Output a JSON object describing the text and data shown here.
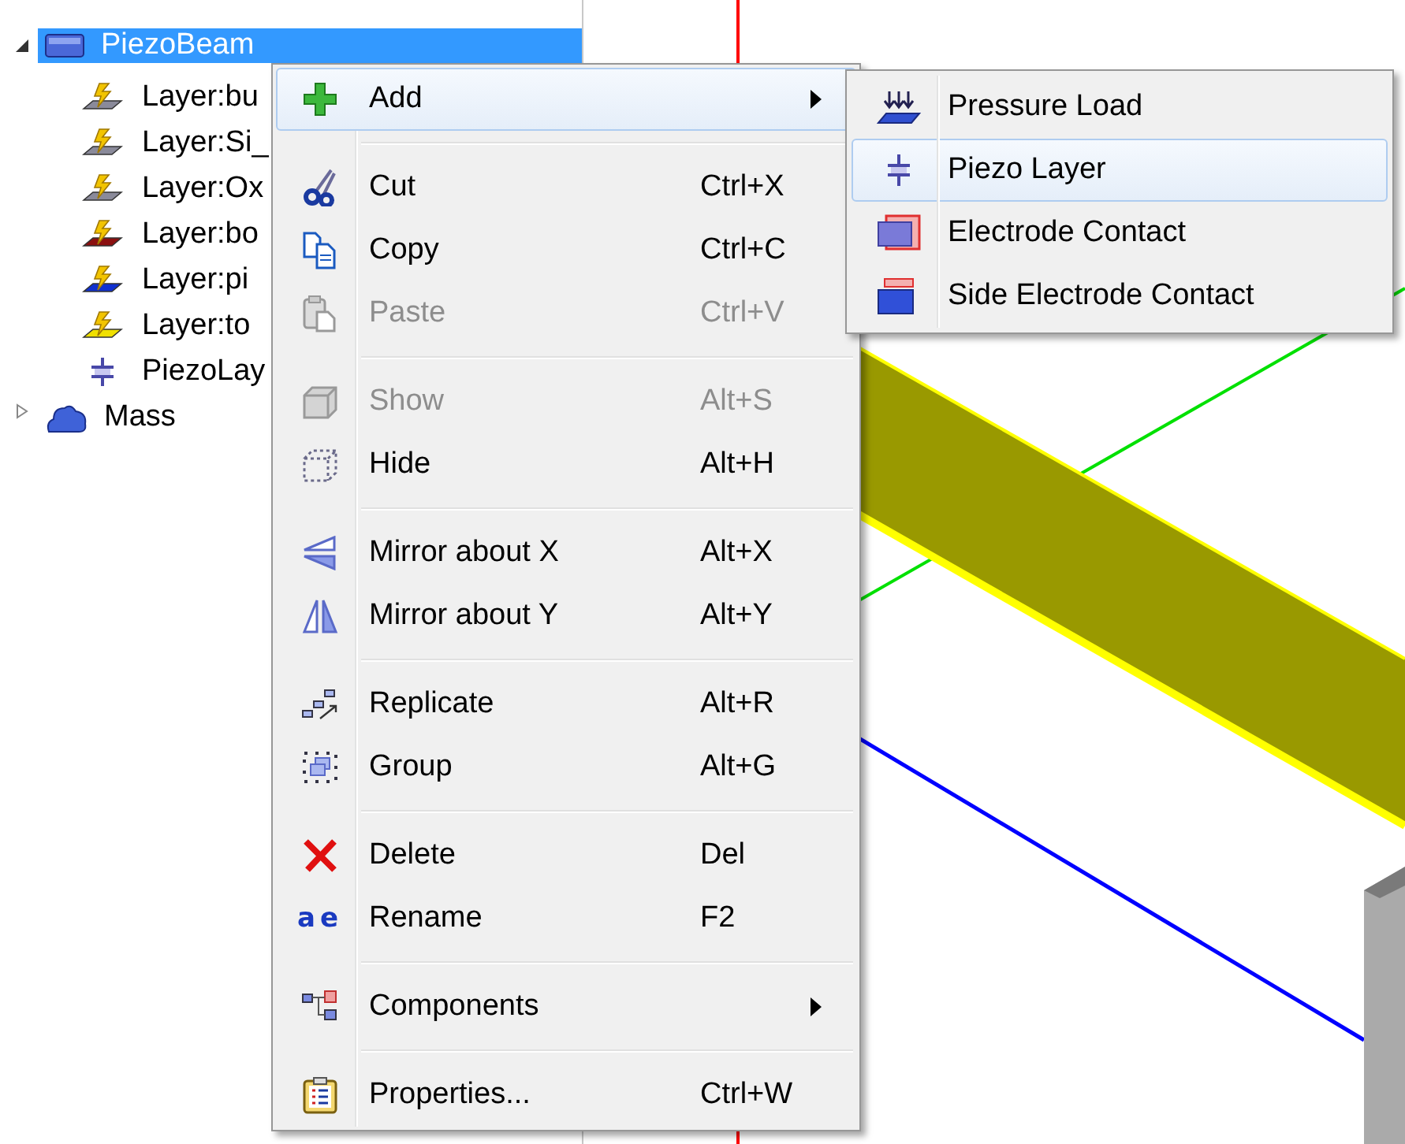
{
  "tree": {
    "items": [
      {
        "label": "PiezoBeam",
        "kind": "beam",
        "expanded": true,
        "selected": true,
        "children": [
          {
            "label": "Layer:bu",
            "kind": "layer",
            "color": "#8a8a9a",
            "selected": false
          },
          {
            "label": "Layer:Si_",
            "kind": "layer",
            "color": "#8a8a9a",
            "selected": false
          },
          {
            "label": "Layer:Ox",
            "kind": "layer",
            "color": "#8a8a9a",
            "selected": false
          },
          {
            "label": "Layer:bo",
            "kind": "layer",
            "color": "#8b1010",
            "selected": false
          },
          {
            "label": "Layer:pi",
            "kind": "layer",
            "color": "#1030d0",
            "selected": false
          },
          {
            "label": "Layer:to",
            "kind": "layer",
            "color": "#f0e000",
            "selected": false
          },
          {
            "label": "PiezoLay",
            "kind": "piezo",
            "selected": false
          }
        ]
      },
      {
        "label": "Mass",
        "kind": "mass",
        "expanded": false,
        "selected": false
      }
    ]
  },
  "context_menu": {
    "items": [
      {
        "kind": "item",
        "label": "Add",
        "submenu": true,
        "disabled": false,
        "selected": true
      },
      {
        "kind": "separator"
      },
      {
        "kind": "item",
        "label": "Cut",
        "shortcut": "Ctrl+X",
        "submenu": false,
        "disabled": false,
        "selected": false
      },
      {
        "kind": "item",
        "label": "Copy",
        "shortcut": "Ctrl+C",
        "submenu": false,
        "disabled": false,
        "selected": false
      },
      {
        "kind": "item",
        "label": "Paste",
        "shortcut": "Ctrl+V",
        "submenu": false,
        "disabled": true,
        "selected": false
      },
      {
        "kind": "separator"
      },
      {
        "kind": "item",
        "label": "Show",
        "shortcut": "Alt+S",
        "submenu": false,
        "disabled": true,
        "selected": false
      },
      {
        "kind": "item",
        "label": "Hide",
        "shortcut": "Alt+H",
        "submenu": false,
        "disabled": false,
        "selected": false
      },
      {
        "kind": "separator"
      },
      {
        "kind": "item",
        "label": "Mirror about X",
        "shortcut": "Alt+X",
        "submenu": false,
        "disabled": false,
        "selected": false
      },
      {
        "kind": "item",
        "label": "Mirror about Y",
        "shortcut": "Alt+Y",
        "submenu": false,
        "disabled": false,
        "selected": false
      },
      {
        "kind": "separator"
      },
      {
        "kind": "item",
        "label": "Replicate",
        "shortcut": "Alt+R",
        "submenu": false,
        "disabled": false,
        "selected": false
      },
      {
        "kind": "item",
        "label": "Group",
        "shortcut": "Alt+G",
        "submenu": false,
        "disabled": false,
        "selected": false
      },
      {
        "kind": "separator"
      },
      {
        "kind": "item",
        "label": "Delete",
        "shortcut": "Del",
        "submenu": false,
        "disabled": false,
        "selected": false
      },
      {
        "kind": "item",
        "label": "Rename",
        "shortcut": "F2",
        "icon_text": "ae",
        "submenu": false,
        "disabled": false,
        "selected": false
      },
      {
        "kind": "separator"
      },
      {
        "kind": "item",
        "label": "Components",
        "submenu": true,
        "disabled": false,
        "selected": false
      },
      {
        "kind": "separator"
      },
      {
        "kind": "item",
        "label": "Properties...",
        "shortcut": "Ctrl+W",
        "submenu": false,
        "disabled": false,
        "selected": false
      }
    ]
  },
  "submenu": {
    "items": [
      {
        "label": "Pressure Load",
        "selected": false
      },
      {
        "label": "Piezo Layer",
        "selected": true
      },
      {
        "label": "Electrode Contact",
        "selected": false
      },
      {
        "label": "Side Electrode Contact",
        "selected": false
      }
    ]
  }
}
